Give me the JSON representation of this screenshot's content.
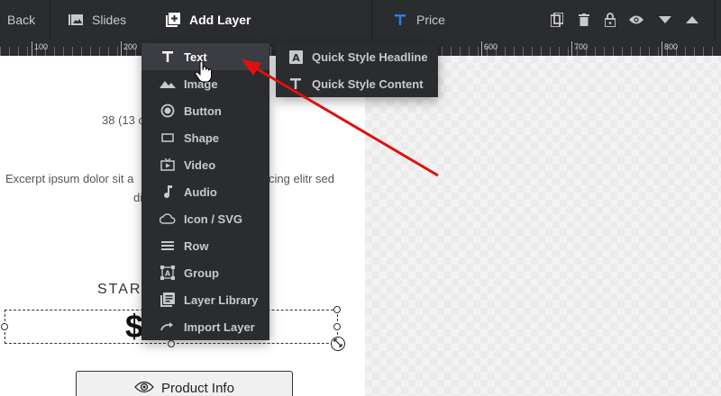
{
  "toolbar": {
    "back_label": "Back",
    "slides_label": "Slides",
    "add_layer_label": "Add Layer",
    "price_label": "Price",
    "accent_color": "#2a7de1"
  },
  "ruler": {
    "labels": [
      "100",
      "200",
      "600",
      "700",
      "800"
    ]
  },
  "canvas": {
    "line_1": "38 (13 c",
    "line_2a": "Excerpt ipsum dolor sit a",
    "line_2b": "cing elitr sed",
    "line_3": "di",
    "starting": "STAR",
    "price_symbol": "$",
    "product_button_label": "Product Info"
  },
  "add_layer_menu": {
    "items": [
      {
        "label": "Text",
        "icon": "text-icon"
      },
      {
        "label": "Image",
        "icon": "image-icon"
      },
      {
        "label": "Button",
        "icon": "button-icon"
      },
      {
        "label": "Shape",
        "icon": "shape-icon"
      },
      {
        "label": "Video",
        "icon": "video-icon"
      },
      {
        "label": "Audio",
        "icon": "audio-icon"
      },
      {
        "label": "Icon / SVG",
        "icon": "cloud-icon"
      },
      {
        "label": "Row",
        "icon": "row-icon"
      },
      {
        "label": "Group",
        "icon": "group-icon"
      },
      {
        "label": "Layer Library",
        "icon": "library-icon"
      },
      {
        "label": "Import Layer",
        "icon": "import-icon"
      }
    ]
  },
  "text_submenu": {
    "items": [
      {
        "label": "Quick Style Headline",
        "icon": "headline-icon"
      },
      {
        "label": "Quick Style Content",
        "icon": "text-icon"
      }
    ]
  },
  "annotation": {
    "arrow_color": "#e01010"
  }
}
